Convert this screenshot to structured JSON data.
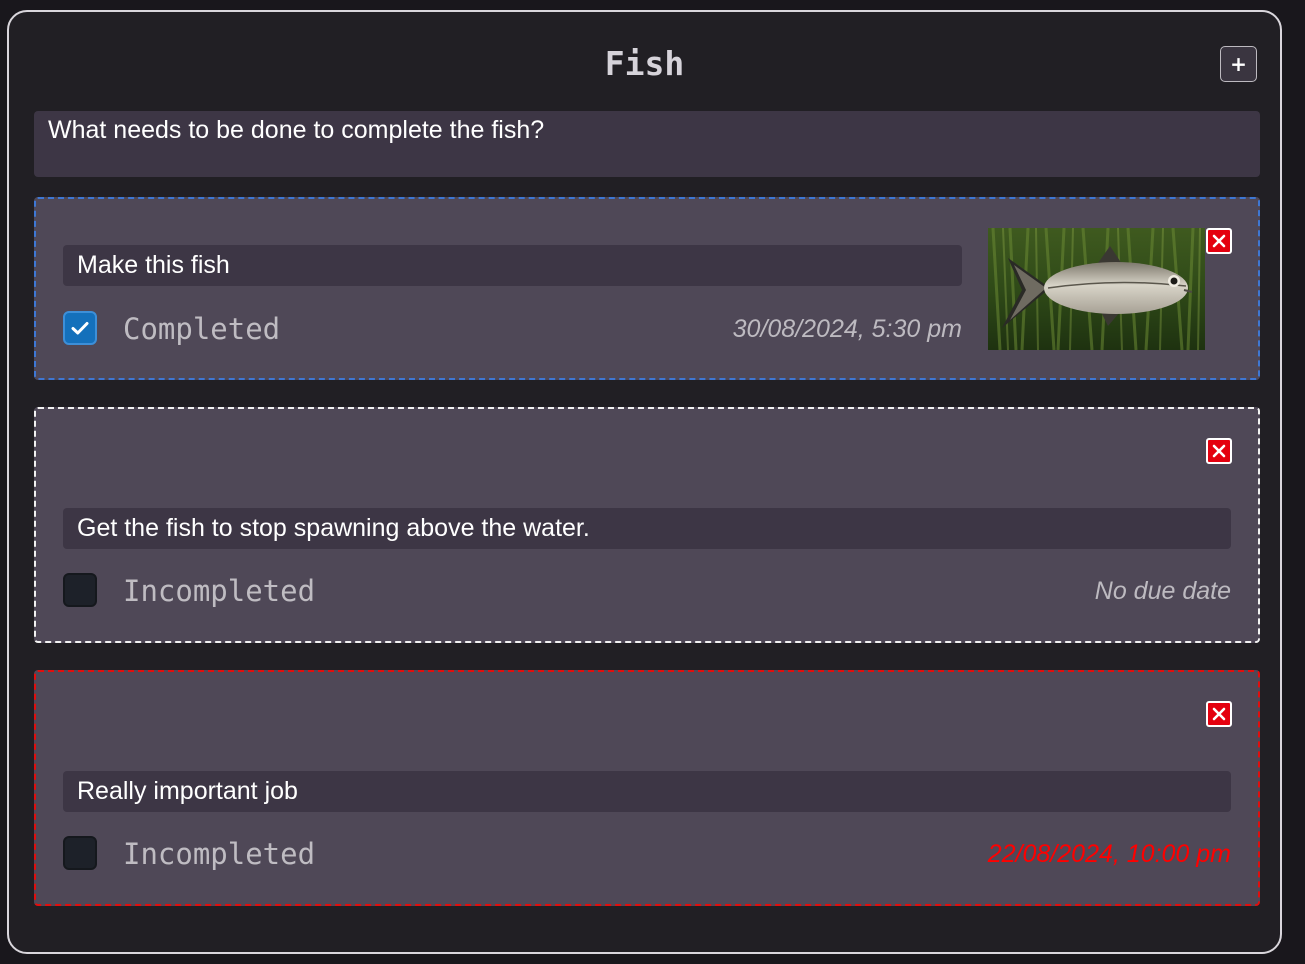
{
  "list": {
    "title": "Fish",
    "add_label": "+",
    "description": "What needs to be done to complete the fish?"
  },
  "tasks": [
    {
      "text": "Make this fish",
      "status": "Completed",
      "completed": true,
      "due": "30/08/2024, 5:30 pm",
      "has_image": true,
      "border_color": "#3e77d4"
    },
    {
      "text": "Get the fish to stop spawning above the water.",
      "status": "Incompleted",
      "completed": false,
      "due": "No due date",
      "has_image": false,
      "border_color": "#f2f2f2"
    },
    {
      "text": "Really important job",
      "status": "Incompleted",
      "completed": false,
      "due": "22/08/2024, 10:00 pm",
      "overdue": true,
      "has_image": false,
      "border_color": "#e10d0d"
    }
  ],
  "icons": {
    "delete": "close-icon",
    "check": "checkmark-icon"
  },
  "colors": {
    "overdue": "#ff0000",
    "checkbox_checked": "#1470bb",
    "delete_button": "#e4000f"
  }
}
